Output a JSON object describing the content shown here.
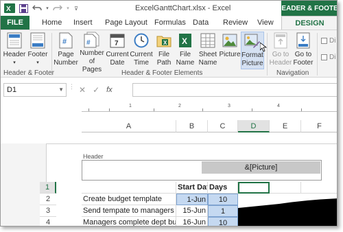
{
  "window": {
    "title": "ExcelGanttChart.xlsx - Excel",
    "context_tab_group": "HEADER & FOOTER"
  },
  "tabs": [
    "FILE",
    "Home",
    "Insert",
    "Page Layout",
    "Formulas",
    "Data",
    "Review",
    "View",
    "DESIGN"
  ],
  "ribbon": {
    "group1": {
      "label": "Header & Footer",
      "buttons": [
        {
          "line1": "Header",
          "line2": "",
          "icon": "header-icon"
        },
        {
          "line1": "Footer",
          "line2": "",
          "icon": "footer-icon"
        }
      ]
    },
    "group2": {
      "label": "Header & Footer Elements",
      "buttons": [
        {
          "line1": "Page",
          "line2": "Number",
          "icon": "page-number-icon"
        },
        {
          "line1": "Number",
          "line2": "of Pages",
          "icon": "number-of-pages-icon"
        },
        {
          "line1": "Current",
          "line2": "Date",
          "icon": "calendar-icon"
        },
        {
          "line1": "Current",
          "line2": "Time",
          "icon": "clock-icon"
        },
        {
          "line1": "File",
          "line2": "Path",
          "icon": "file-path-icon"
        },
        {
          "line1": "File",
          "line2": "Name",
          "icon": "file-name-icon"
        },
        {
          "line1": "Sheet",
          "line2": "Name",
          "icon": "sheet-name-icon"
        },
        {
          "line1": "Picture",
          "line2": "",
          "icon": "picture-icon"
        },
        {
          "line1": "Format",
          "line2": "Picture",
          "icon": "format-picture-icon"
        }
      ]
    },
    "group3": {
      "label": "Navigation",
      "buttons": [
        {
          "line1": "Go to",
          "line2": "Header",
          "icon": "go-to-header-icon"
        },
        {
          "line1": "Go to",
          "line2": "Footer",
          "icon": "go-to-footer-icon"
        }
      ]
    },
    "options": [
      "Di",
      "Di"
    ]
  },
  "formula_bar": {
    "name_box": "D1",
    "fx": "fx",
    "value": ""
  },
  "sheet": {
    "columns": [
      "A",
      "B",
      "C",
      "D",
      "E",
      "F"
    ],
    "header_label": "Header",
    "header_right_text": "&[Picture]",
    "rows": [
      {
        "num": "1",
        "a": "",
        "b": "Start Date",
        "c": "Days"
      },
      {
        "num": "2",
        "a": "Create budget template",
        "b": "1-Jun",
        "c": "10"
      },
      {
        "num": "3",
        "a": "Send tempate to managers",
        "b": "15-Jun",
        "c": "1"
      },
      {
        "num": "4",
        "a": "Managers complete dept budge",
        "b": "16-Jun",
        "c": "10"
      }
    ],
    "ruler_marks": [
      "1",
      "2",
      "3",
      "4"
    ]
  },
  "colors": {
    "accent": "#217346",
    "cell_blue": "#c5d9f1"
  }
}
